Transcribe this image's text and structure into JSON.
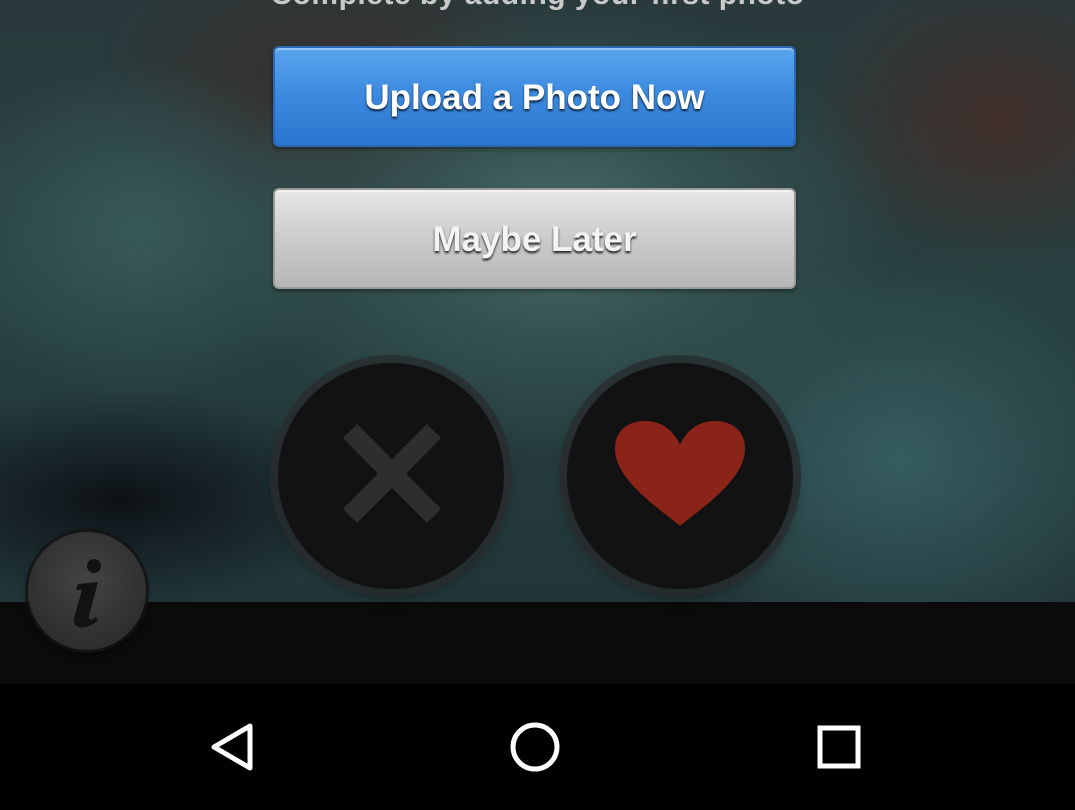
{
  "prompt": {
    "partial_text": "Complete by adding your first photo"
  },
  "dialog": {
    "upload_label": "Upload a Photo Now",
    "later_label": "Maybe Later",
    "upload_color": "#3d8be0",
    "later_color": "#c9c9c9"
  },
  "actions": {
    "nope_icon": "x-icon",
    "like_icon": "heart-icon",
    "info_icon": "info-icon",
    "like_color": "#8a2418",
    "nope_color": "#2e2e2e"
  },
  "navbar": {
    "back_icon": "back-triangle-icon",
    "home_icon": "home-circle-icon",
    "recents_icon": "recents-square-icon"
  }
}
